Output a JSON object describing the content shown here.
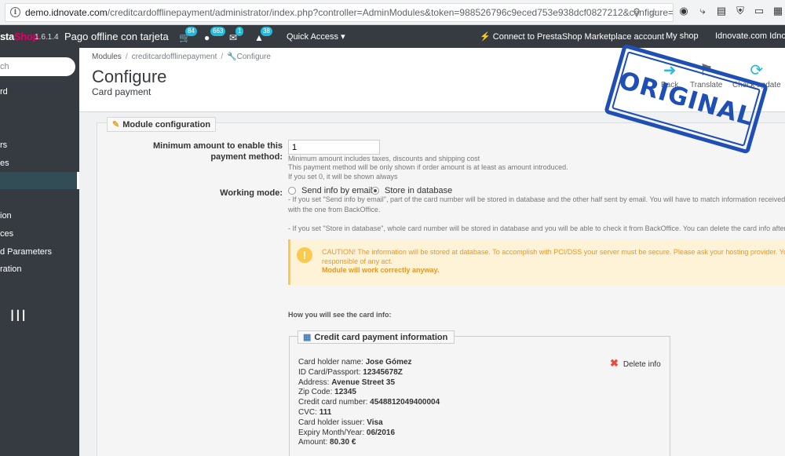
{
  "browser": {
    "url_domain": "demo.idnovate.com",
    "url_path": "/creditcardofflinepayment/administrator/index.php?controller=AdminModules&token=988526796c9eced753e938dcf0827212&configure="
  },
  "topnav": {
    "logo_part1": "sta",
    "logo_part2": "Shop",
    "version": "1.6.1.4",
    "shop_name": "Pago offline con tarjeta",
    "orders_count": "84",
    "customers_count": "663",
    "messages_count": "1",
    "notifications_count": "38",
    "quick_access": "Quick Access",
    "marketplace": "Connect to PrestaShop Marketplace account",
    "my_shop": "My shop",
    "user": "Idnovate.com Idnov"
  },
  "sidebar": {
    "search_placeholder": "ch",
    "items": [
      "rd",
      "rs",
      "es",
      "ion",
      "ces",
      "d Parameters",
      "ration"
    ]
  },
  "page": {
    "breadcrumb": [
      "Modules",
      "creditcardofflinepayment",
      "Configure"
    ],
    "title": "Configure",
    "subtitle": "Card payment",
    "toolbar": {
      "back": "Back",
      "translate": "Translate",
      "check_update": "Check update"
    }
  },
  "panel": {
    "title": "Module configuration",
    "min_amount_label_1": "Minimum amount to enable this",
    "min_amount_label_2": "payment method:",
    "min_amount_value": "1",
    "min_help_1": "Minimum amount includes taxes, discounts and shipping cost",
    "min_help_2": "This payment method will be only shown if order amount is at least as amount introduced.",
    "min_help_3": "If you set 0, it will be shown always",
    "working_mode_label": "Working mode:",
    "radio_email": "Send info by email",
    "radio_db": "Store in database",
    "mode_help_1": "- If you set \"Send info by email\", part of the card number will be stored in database and the other half sent by email. You will have to match information received fr",
    "mode_help_2": "with the one from BackOffice.",
    "mode_help_3": "- If you set \"Store in database\", whole card number will be stored in database and you will be able to check it from BackOffice. You can delete the card info afterw",
    "alert_line1": "CAUTION! The information will be stored at database. To accomplish with PCI/DSS your server must be secure. Please ask your hosting provider. You ar",
    "alert_line2": "responsible of any act.",
    "alert_line3": "Module will work correctly anyway.",
    "see_label": "How you will see the card info:"
  },
  "card": {
    "title": "Credit card payment information",
    "delete": "Delete info",
    "lines": [
      {
        "label": "Card holder name:",
        "value": "Jose Gómez"
      },
      {
        "label": "ID Card/Passport:",
        "value": "12345678Z"
      },
      {
        "label": "Address:",
        "value": "Avenue Street 35"
      },
      {
        "label": "Zip Code:",
        "value": "12345"
      },
      {
        "label": "Credit card number:",
        "value": "4548812049400004"
      },
      {
        "label": "CVC:",
        "value": "111"
      },
      {
        "label": "Card holder issuer:",
        "value": "Visa"
      },
      {
        "label": "Expiry Month/Year:",
        "value": "06/2016"
      },
      {
        "label": "Amount:",
        "value": "80.30 €"
      }
    ]
  },
  "stamp": "ORIGINAL"
}
